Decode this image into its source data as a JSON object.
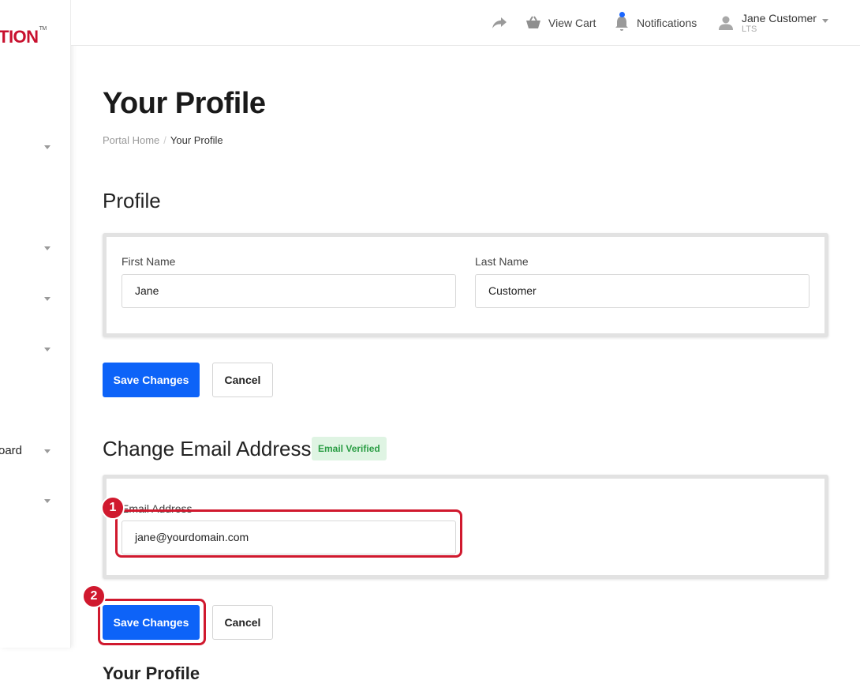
{
  "sidebar": {
    "logo_text": "TION",
    "logo_tm": "TM",
    "partial_item": "oard"
  },
  "topbar": {
    "share_icon": "share-arrow-icon",
    "cart_label": "View Cart",
    "notifications_label": "Notifications",
    "user_name": "Jane Customer",
    "user_sub": "LTS"
  },
  "page": {
    "title": "Your Profile",
    "breadcrumb": {
      "home": "Portal Home",
      "separator": "/",
      "current": "Your Profile"
    }
  },
  "profile": {
    "section_title": "Profile",
    "first_name_label": "First Name",
    "first_name_value": "Jane",
    "last_name_label": "Last Name",
    "last_name_value": "Customer",
    "save_label": "Save Changes",
    "cancel_label": "Cancel"
  },
  "email": {
    "section_title": "Change Email Address",
    "verified_badge": "Email Verified",
    "email_label": "Email Address",
    "email_value": "jane@yourdomain.com",
    "save_label": "Save Changes",
    "cancel_label": "Cancel"
  },
  "callouts": [
    "1",
    "2"
  ],
  "cut_heading": "Your Profile",
  "colors": {
    "brand_red": "#c8102e",
    "primary_blue": "#0d63f8",
    "callout_red": "#d0192e",
    "verified_green": "#2a9d44"
  }
}
